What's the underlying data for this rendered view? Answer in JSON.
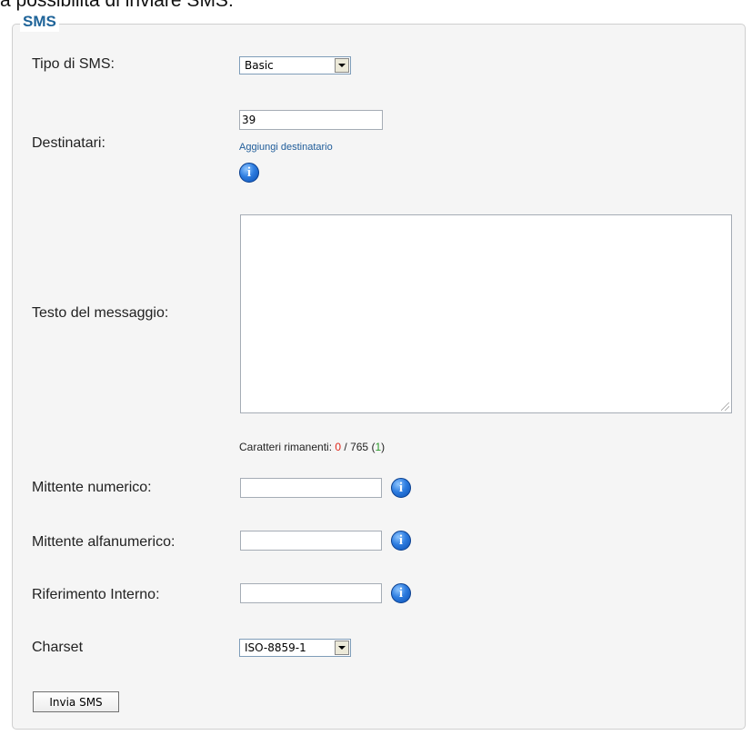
{
  "page": {
    "intro_text": "a possibilità di inviare SMS:"
  },
  "form": {
    "legend": "SMS",
    "tipo": {
      "label": "Tipo di SMS:",
      "selected": "Basic"
    },
    "destinatari": {
      "label": "Destinatari:",
      "value": "39",
      "add_link": "Aggiungi destinatario",
      "icon": "info-icon"
    },
    "testo": {
      "label": "Testo del messaggio:",
      "value": ""
    },
    "counter": {
      "prefix": "Caratteri rimanenti: ",
      "remaining": "0",
      "separator": " / ",
      "total": "765",
      "open": " (",
      "sms_count": "1",
      "close": ")"
    },
    "mittente_numerico": {
      "label": "Mittente numerico:",
      "value": "",
      "icon": "info-icon"
    },
    "mittente_alfanumerico": {
      "label": "Mittente alfanumerico:",
      "value": "",
      "icon": "info-icon"
    },
    "riferimento": {
      "label": "Riferimento Interno:",
      "value": "",
      "icon": "info-icon"
    },
    "charset": {
      "label": "Charset",
      "selected": "ISO-8859-1"
    },
    "submit_label": "Invia SMS"
  },
  "colors": {
    "legend": "#1f6499",
    "link": "#1f5c99",
    "remaining": "#e0281c",
    "sms_count": "#2a9a2a",
    "panel_background": "#f5f5f5"
  }
}
